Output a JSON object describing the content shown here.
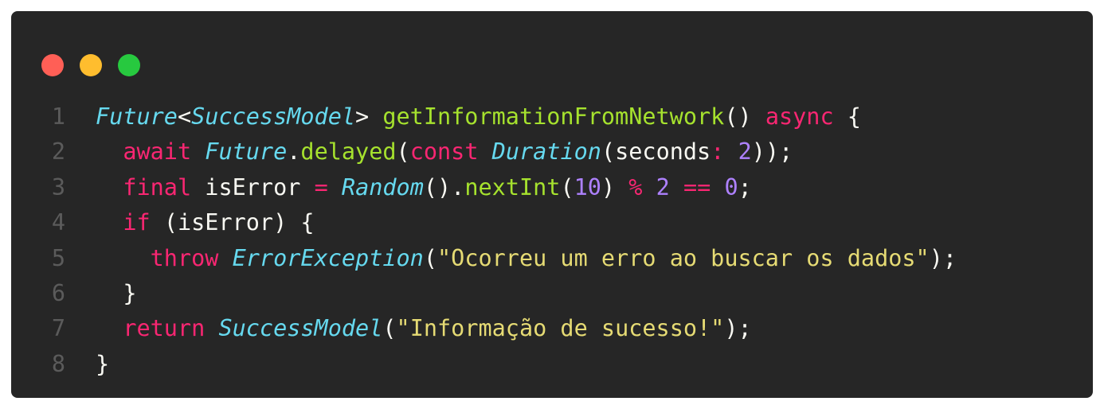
{
  "window": {
    "buttons": {
      "close_color": "#ff5f56",
      "minimize_color": "#ffbd2e",
      "maximize_color": "#27c93f"
    }
  },
  "theme": {
    "background": "#262626",
    "line_number_color": "#5b5b5b",
    "plain_color": "#f8f8f2",
    "type_color": "#66d9ef",
    "keyword_color": "#f92672",
    "function_color": "#a6e22e",
    "number_color": "#ae81ff",
    "string_color": "#e6db74"
  },
  "code": {
    "lines": [
      {
        "number": "1",
        "tokens": [
          {
            "t": "Future",
            "k": "ty"
          },
          {
            "t": "<",
            "k": "pl"
          },
          {
            "t": "SuccessModel",
            "k": "ty"
          },
          {
            "t": "> ",
            "k": "pl"
          },
          {
            "t": "getInformationFromNetwork",
            "k": "fn"
          },
          {
            "t": "() ",
            "k": "pl"
          },
          {
            "t": "async",
            "k": "kw"
          },
          {
            "t": " {",
            "k": "pl"
          }
        ]
      },
      {
        "number": "2",
        "tokens": [
          {
            "t": "  ",
            "k": "pl"
          },
          {
            "t": "await",
            "k": "kw"
          },
          {
            "t": " ",
            "k": "pl"
          },
          {
            "t": "Future",
            "k": "ty"
          },
          {
            "t": ".",
            "k": "pl"
          },
          {
            "t": "delayed",
            "k": "fn"
          },
          {
            "t": "(",
            "k": "pl"
          },
          {
            "t": "const",
            "k": "kw"
          },
          {
            "t": " ",
            "k": "pl"
          },
          {
            "t": "Duration",
            "k": "ty"
          },
          {
            "t": "(seconds",
            "k": "pl"
          },
          {
            "t": ":",
            "k": "kw"
          },
          {
            "t": " ",
            "k": "pl"
          },
          {
            "t": "2",
            "k": "num"
          },
          {
            "t": "));",
            "k": "pl"
          }
        ]
      },
      {
        "number": "3",
        "tokens": [
          {
            "t": "  ",
            "k": "pl"
          },
          {
            "t": "final",
            "k": "kw"
          },
          {
            "t": " isError ",
            "k": "pl"
          },
          {
            "t": "=",
            "k": "kw"
          },
          {
            "t": " ",
            "k": "pl"
          },
          {
            "t": "Random",
            "k": "ty"
          },
          {
            "t": "().",
            "k": "pl"
          },
          {
            "t": "nextInt",
            "k": "fn"
          },
          {
            "t": "(",
            "k": "pl"
          },
          {
            "t": "10",
            "k": "num"
          },
          {
            "t": ") ",
            "k": "pl"
          },
          {
            "t": "%",
            "k": "kw"
          },
          {
            "t": " ",
            "k": "pl"
          },
          {
            "t": "2",
            "k": "num"
          },
          {
            "t": " ",
            "k": "pl"
          },
          {
            "t": "==",
            "k": "kw"
          },
          {
            "t": " ",
            "k": "pl"
          },
          {
            "t": "0",
            "k": "num"
          },
          {
            "t": ";",
            "k": "pl"
          }
        ]
      },
      {
        "number": "4",
        "tokens": [
          {
            "t": "  ",
            "k": "pl"
          },
          {
            "t": "if",
            "k": "kw"
          },
          {
            "t": " (isError) {",
            "k": "pl"
          }
        ]
      },
      {
        "number": "5",
        "tokens": [
          {
            "t": "    ",
            "k": "pl"
          },
          {
            "t": "throw",
            "k": "kw"
          },
          {
            "t": " ",
            "k": "pl"
          },
          {
            "t": "ErrorException",
            "k": "ty"
          },
          {
            "t": "(",
            "k": "pl"
          },
          {
            "t": "\"Ocorreu um erro ao buscar os dados\"",
            "k": "str"
          },
          {
            "t": ");",
            "k": "pl"
          }
        ]
      },
      {
        "number": "6",
        "tokens": [
          {
            "t": "  }",
            "k": "pl"
          }
        ]
      },
      {
        "number": "7",
        "tokens": [
          {
            "t": "  ",
            "k": "pl"
          },
          {
            "t": "return",
            "k": "kw"
          },
          {
            "t": " ",
            "k": "pl"
          },
          {
            "t": "SuccessModel",
            "k": "ty"
          },
          {
            "t": "(",
            "k": "pl"
          },
          {
            "t": "\"Informação de sucesso!\"",
            "k": "str"
          },
          {
            "t": ");",
            "k": "pl"
          }
        ]
      },
      {
        "number": "8",
        "tokens": [
          {
            "t": "}",
            "k": "pl"
          }
        ]
      }
    ]
  }
}
